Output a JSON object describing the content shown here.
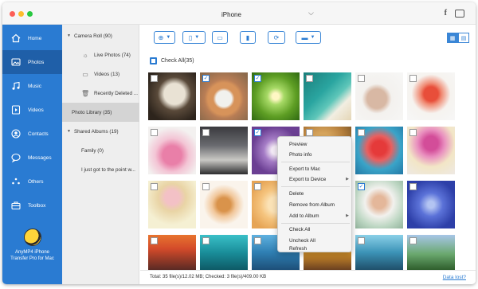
{
  "titlebar": {
    "device_name": "iPhone",
    "apple_glyph": "",
    "chevron": "⌵",
    "facebook_glyph": "f"
  },
  "sidebar": {
    "items": [
      {
        "label": "Home",
        "icon": "home-icon",
        "active": false
      },
      {
        "label": "Photos",
        "icon": "photos-icon",
        "active": true
      },
      {
        "label": "Music",
        "icon": "music-icon",
        "active": false
      },
      {
        "label": "Videos",
        "icon": "videos-icon",
        "active": false
      },
      {
        "label": "Contacts",
        "icon": "contacts-icon",
        "active": false
      },
      {
        "label": "Messages",
        "icon": "messages-icon",
        "active": false
      },
      {
        "label": "Others",
        "icon": "others-icon",
        "active": false
      },
      {
        "label": "Toolbox",
        "icon": "toolbox-icon",
        "active": false
      }
    ],
    "brand_line1": "AnyMP4 iPhone",
    "brand_line2": "Transfer Pro for Mac",
    "accent_color": "#2a7bd2"
  },
  "tree": {
    "camera_roll": "Camera Roll (90)",
    "live_photos": "Live Photos (74)",
    "videos": "Videos (13)",
    "recently_deleted": "Recently Deleted ...",
    "photo_library": "Photo Library (35)",
    "shared_albums": "Shared Albums (19)",
    "family": "Family (0)",
    "shared_note": "I just got to the point w..."
  },
  "main": {
    "check_all": "Check All(35)",
    "status": "Total: 35 file(s)/12.02 MB; Checked: 3 file(s)/409.00 KB",
    "data_lost": "Data lost?"
  },
  "context_menu": {
    "items": [
      "Preview",
      "Photo info",
      "Export to Mac",
      "Export to Device",
      "Delete",
      "Remove from Album",
      "Add to Album",
      "Check All",
      "Uncheck All",
      "Refresh"
    ]
  }
}
